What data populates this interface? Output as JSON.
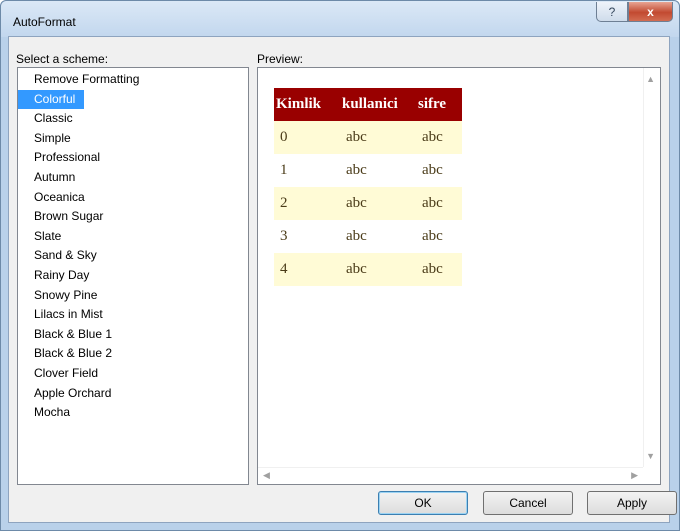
{
  "window": {
    "title": "AutoFormat",
    "help_glyph": "?",
    "close_glyph": "x"
  },
  "schemes": {
    "label": "Select a scheme:",
    "selected": "Colorful",
    "items": [
      "Remove Formatting",
      "Colorful",
      "Classic",
      "Simple",
      "Professional",
      "Autumn",
      "Oceanica",
      "Brown Sugar",
      "Slate",
      "Sand & Sky",
      "Rainy Day",
      "Snowy Pine",
      "Lilacs in Mist",
      "Black & Blue 1",
      "Black & Blue 2",
      "Clover Field",
      "Apple Orchard",
      "Mocha"
    ]
  },
  "preview": {
    "label": "Preview:",
    "headers": [
      "Kimlik",
      "kullanici",
      "sifre"
    ],
    "rows": [
      [
        "0",
        "abc",
        "abc"
      ],
      [
        "1",
        "abc",
        "abc"
      ],
      [
        "2",
        "abc",
        "abc"
      ],
      [
        "3",
        "abc",
        "abc"
      ],
      [
        "4",
        "abc",
        "abc"
      ]
    ],
    "colors": {
      "header_bg": "#990000",
      "header_fg": "#ffffff",
      "odd_row_bg": "#fffbd6",
      "even_row_bg": "#ffffff"
    }
  },
  "buttons": {
    "ok": "OK",
    "cancel": "Cancel",
    "apply": "Apply"
  }
}
